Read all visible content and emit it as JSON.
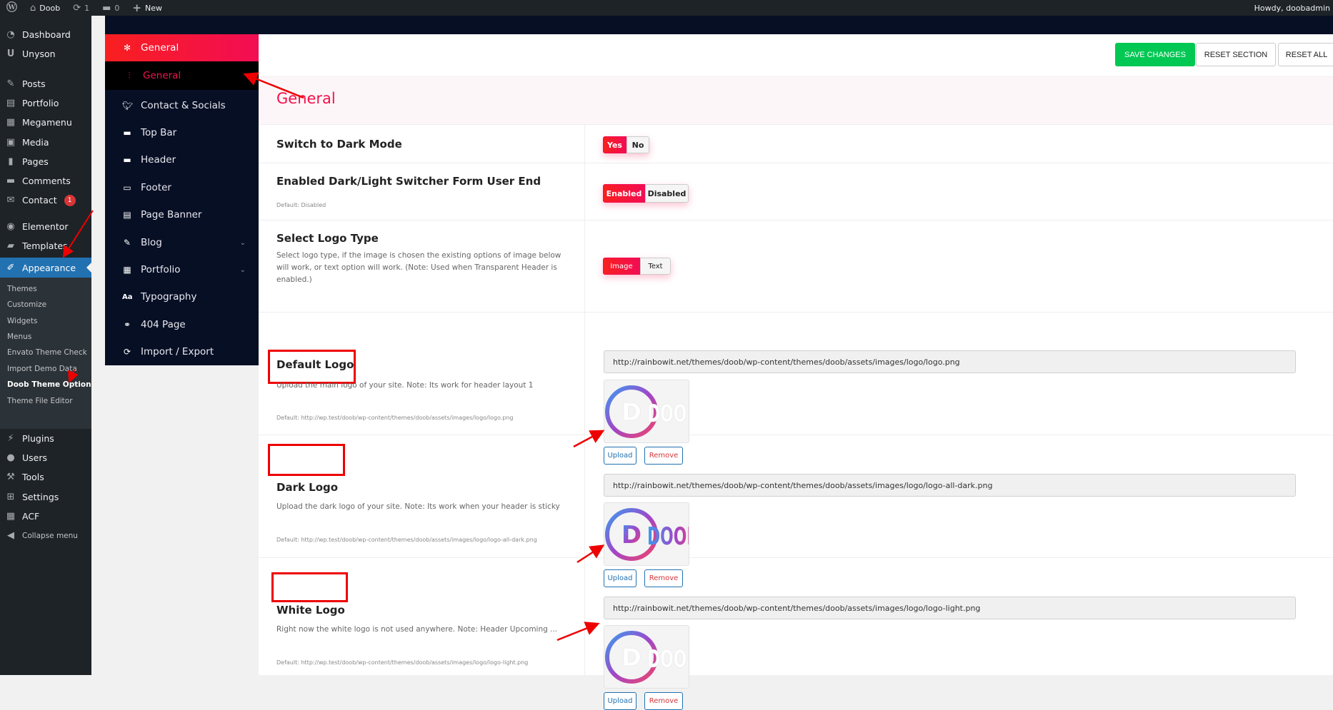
{
  "admin_bar": {
    "site_name": "Doob",
    "updates_count": "1",
    "comments_count": "0",
    "new_label": "New",
    "howdy": "Howdy, doobadmin"
  },
  "wp_menu": {
    "items": [
      {
        "label": "Dashboard",
        "icon": "dashboard-icon"
      },
      {
        "label": "Unyson",
        "icon": "unyson-icon"
      },
      {
        "label": "Posts",
        "icon": "pushpin-icon"
      },
      {
        "label": "Portfolio",
        "icon": "portfolio-icon"
      },
      {
        "label": "Megamenu",
        "icon": "megamenu-icon"
      },
      {
        "label": "Media",
        "icon": "media-icon"
      },
      {
        "label": "Pages",
        "icon": "pages-icon"
      },
      {
        "label": "Comments",
        "icon": "comment-icon"
      },
      {
        "label": "Contact",
        "icon": "envelope-icon",
        "badge": "1"
      },
      {
        "label": "Elementor",
        "icon": "elementor-icon"
      },
      {
        "label": "Templates",
        "icon": "folder-icon"
      },
      {
        "label": "Appearance",
        "icon": "paintbrush-icon",
        "current": true
      },
      {
        "label": "Plugins",
        "icon": "plugin-icon"
      },
      {
        "label": "Users",
        "icon": "user-icon"
      },
      {
        "label": "Tools",
        "icon": "wrench-icon"
      },
      {
        "label": "Settings",
        "icon": "settings-icon"
      },
      {
        "label": "ACF",
        "icon": "acf-icon"
      },
      {
        "label": "Collapse menu",
        "icon": "collapse-icon"
      }
    ],
    "appearance_submenu": [
      {
        "label": "Themes"
      },
      {
        "label": "Customize"
      },
      {
        "label": "Widgets"
      },
      {
        "label": "Menus"
      },
      {
        "label": "Envato Theme Check"
      },
      {
        "label": "Import Demo Data"
      },
      {
        "label": "Doob Theme Options",
        "current": true
      },
      {
        "label": "Theme File Editor"
      }
    ]
  },
  "options_sidebar": {
    "tabs": [
      {
        "label": "General",
        "icon": "gear-icon",
        "state": "parent-active"
      },
      {
        "label": "General",
        "icon": "sliders-icon",
        "state": "sub-active"
      },
      {
        "label": "Contact & Socials",
        "icon": "twitter-icon"
      },
      {
        "label": "Top Bar",
        "icon": "minus-icon"
      },
      {
        "label": "Header",
        "icon": "minus-icon"
      },
      {
        "label": "Footer",
        "icon": "monitor-icon"
      },
      {
        "label": "Page Banner",
        "icon": "banner-icon"
      },
      {
        "label": "Blog",
        "icon": "edit-icon",
        "has_children": true
      },
      {
        "label": "Portfolio",
        "icon": "grid-icon",
        "has_children": true
      },
      {
        "label": "Typography",
        "icon": "font-icon"
      },
      {
        "label": "404 Page",
        "icon": "link-broken-icon"
      },
      {
        "label": "Import / Export",
        "icon": "refresh-icon"
      }
    ]
  },
  "actions": {
    "save": "SAVE CHANGES",
    "reset_section": "RESET SECTION",
    "reset_all": "RESET ALL"
  },
  "section": {
    "title": "General"
  },
  "options": {
    "dark_mode": {
      "label": "Switch to Dark Mode",
      "choices": [
        "Yes",
        "No"
      ],
      "selected": "Yes"
    },
    "switcher": {
      "label": "Enabled Dark/Light Switcher Form User End",
      "default": "Default: Disabled",
      "choices": [
        "Enabled",
        "Disabled"
      ],
      "selected": "Enabled"
    },
    "logo_type": {
      "label": "Select Logo Type",
      "desc": "Select logo type, if the image is chosen the existing options of image below will work, or text option will work. (Note: Used when Transparent Header is enabled.)",
      "choices": [
        "Image",
        "Text"
      ],
      "selected": "Image"
    },
    "default_logo": {
      "label": "Default Logo",
      "desc": "Upload the main logo of your site. Note: Its work for header layout 1",
      "default": "Default: http://wp.test/doob/wp-content/themes/doob/assets/images/logo/logo.png",
      "value": "http://rainbowit.net/themes/doob/wp-content/themes/doob/assets/images/logo/logo.png",
      "upload": "Upload",
      "remove": "Remove",
      "preview_text": "DOOB",
      "preview_letter": "D"
    },
    "dark_logo": {
      "label": "Dark Logo",
      "desc": "Upload the dark logo of your site. Note: Its work when your header is sticky",
      "default": "Default: http://wp.test/doob/wp-content/themes/doob/assets/images/logo/logo-all-dark.png",
      "value": "http://rainbowit.net/themes/doob/wp-content/themes/doob/assets/images/logo/logo-all-dark.png",
      "upload": "Upload",
      "remove": "Remove",
      "preview_text": "DOOB",
      "preview_letter": "D"
    },
    "white_logo": {
      "label": "White Logo",
      "desc": "Right now the white logo is not used anywhere. Note: Header Upcoming ...",
      "default": "Default: http://wp.test/doob/wp-content/themes/doob/assets/images/logo/logo-light.png",
      "value": "http://rainbowit.net/themes/doob/wp-content/themes/doob/assets/images/logo/logo-light.png",
      "upload": "Upload",
      "remove": "Remove",
      "preview_text": "DOOB",
      "preview_letter": "D"
    }
  },
  "colors": {
    "accent": "#f4114c",
    "save_green": "#00c853",
    "wp_blue": "#2271b1",
    "options_bg": "#070f25",
    "annotation_red": "#ee0000"
  }
}
